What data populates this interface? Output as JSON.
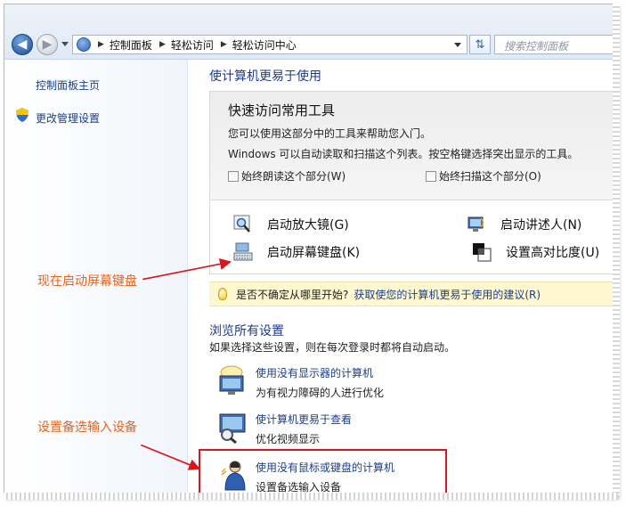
{
  "address_bar": {
    "breadcrumbs": [
      "控制面板",
      "轻松访问",
      "轻松访问中心"
    ],
    "search_placeholder": "搜索控制面板"
  },
  "sidebar": {
    "items": [
      {
        "label": "控制面板主页"
      },
      {
        "label": "更改管理设置",
        "icon": "shield-icon"
      }
    ]
  },
  "main": {
    "title": "使计算机更易于使用",
    "quick_access": {
      "title": "快速访问常用工具",
      "line1": "您可以使用这部分中的工具来帮助您入门。",
      "line2": "Windows 可以自动读取和扫描这个列表。按空格键选择突出显示的工具。",
      "checkbox_read": "始终朗读这个部分(W)",
      "checkbox_scan": "始终扫描这个部分(O)",
      "tools": [
        {
          "label": "启动放大镜(G)",
          "icon": "magnifier-icon"
        },
        {
          "label": "启动讲述人(N)",
          "icon": "narrator-icon"
        },
        {
          "label": "启动屏幕键盘(K)",
          "icon": "keyboard-icon"
        },
        {
          "label": "设置高对比度(U)",
          "icon": "contrast-icon"
        }
      ]
    },
    "tip": {
      "text": "是否不确定从哪里开始?",
      "link": "获取使您的计算机更易于使用的建议(R)"
    },
    "browse": {
      "title": "浏览所有设置",
      "subtitle": "如果选择这些设置，则在每次登录时都将自动启动。",
      "items": [
        {
          "link": "使用没有显示器的计算机",
          "desc": "为有视力障碍的人进行优化"
        },
        {
          "link": "使计算机更易于查看",
          "desc": "优化视频显示"
        },
        {
          "link": "使用没有鼠标或键盘的计算机",
          "desc": "设置备选输入设备"
        }
      ]
    }
  },
  "annotations": {
    "note1": "现在启动屏幕键盘",
    "note2": "设置备选输入设备"
  },
  "colors": {
    "link": "#1a3f8c",
    "heading": "#1e3a8a",
    "annotation": "#e8631c",
    "highlight": "#d8161b"
  }
}
